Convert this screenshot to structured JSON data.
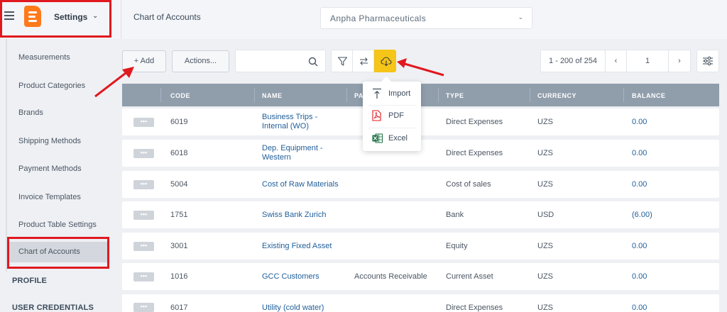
{
  "header": {
    "app_menu_label": "Settings",
    "page_title": "Chart of Accounts",
    "company": "Anpha Pharmaceuticals"
  },
  "sidebar": {
    "items": [
      {
        "label": "Measurements"
      },
      {
        "label": "Product Categories"
      },
      {
        "label": "Brands"
      },
      {
        "label": "Shipping Methods"
      },
      {
        "label": "Payment Methods"
      },
      {
        "label": "Invoice Templates"
      },
      {
        "label": "Product Table Settings"
      },
      {
        "label": "Chart of Accounts",
        "active": true
      }
    ],
    "sections": [
      "PROFILE",
      "USER CREDENTIALS"
    ]
  },
  "toolbar": {
    "add_label": "+ Add",
    "actions_label": "Actions...",
    "search_placeholder": "",
    "pager_range": "1 - 200 of 254",
    "page_number": "1"
  },
  "export_menu": {
    "items": [
      {
        "label": "Import",
        "icon": "import-icon"
      },
      {
        "label": "PDF",
        "icon": "pdf-icon"
      },
      {
        "label": "Excel",
        "icon": "excel-icon"
      }
    ]
  },
  "table": {
    "columns": [
      "CODE",
      "NAME",
      "PA",
      "TYPE",
      "CURRENCY",
      "BALANCE"
    ],
    "rows": [
      {
        "code": "6019",
        "name": "Business Trips - Internal (WO)",
        "parent": "",
        "type": "Direct Expenses",
        "currency": "UZS",
        "balance": "0.00"
      },
      {
        "code": "6018",
        "name": "Dep. Equipment - Western",
        "parent": "",
        "type": "Direct Expenses",
        "currency": "UZS",
        "balance": "0.00"
      },
      {
        "code": "5004",
        "name": "Cost of Raw Materials",
        "parent": "",
        "type": "Cost of sales",
        "currency": "UZS",
        "balance": "0.00"
      },
      {
        "code": "1751",
        "name": "Swiss Bank Zurich",
        "parent": "",
        "type": "Bank",
        "currency": "USD",
        "balance": "(6.00)"
      },
      {
        "code": "3001",
        "name": "Existing Fixed Asset",
        "parent": "",
        "type": "Equity",
        "currency": "UZS",
        "balance": "0.00"
      },
      {
        "code": "1016",
        "name": "GCC Customers",
        "parent": "Accounts Receivable",
        "type": "Current Asset",
        "currency": "UZS",
        "balance": "0.00"
      },
      {
        "code": "6017",
        "name": "Utility (cold water)",
        "parent": "",
        "type": "Direct Expenses",
        "currency": "UZS",
        "balance": "0.00"
      }
    ]
  },
  "colors": {
    "accent": "#f5c518",
    "brand": "#ff7a1a",
    "link": "#1f5e99",
    "table_header": "#909dab",
    "highlight": "#e0191f"
  }
}
